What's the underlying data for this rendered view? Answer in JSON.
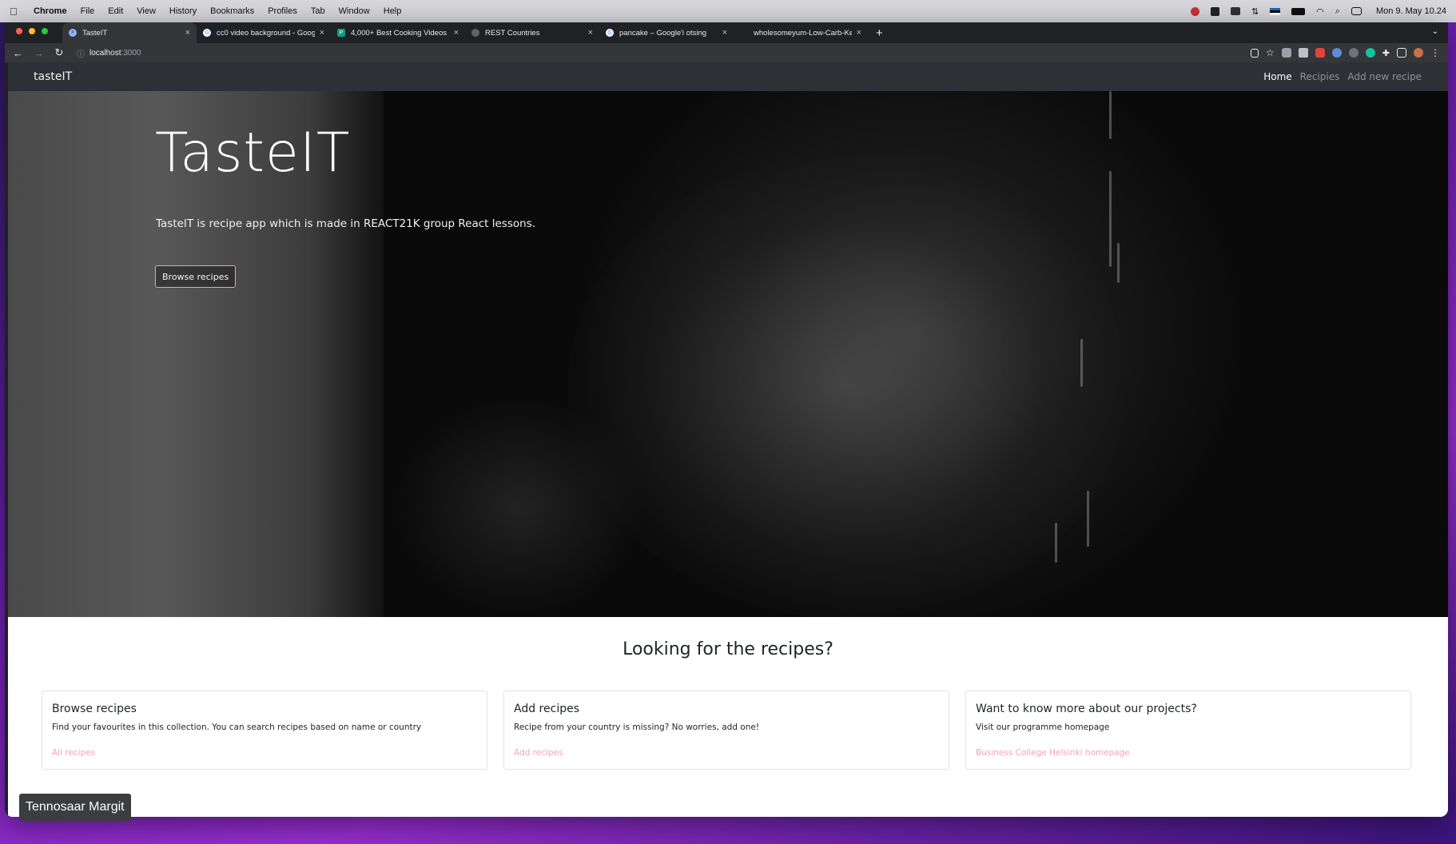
{
  "menubar": {
    "app": "Chrome",
    "items": [
      "File",
      "Edit",
      "View",
      "History",
      "Bookmarks",
      "Profiles",
      "Tab",
      "Window",
      "Help"
    ],
    "clock": "Mon 9. May 10.24"
  },
  "browser": {
    "tabs": [
      {
        "title": "TasteIT",
        "active": true
      },
      {
        "title": "cc0 video background - Googl",
        "active": false
      },
      {
        "title": "4,000+ Best Cooking Videos ·",
        "active": false
      },
      {
        "title": "REST Countries",
        "active": false
      },
      {
        "title": "pancake – Google'i otsing",
        "active": false
      },
      {
        "title": "wholesomeyum-Low-Carb-Ke",
        "active": false
      }
    ],
    "url_host": "localhost",
    "url_port": ":3000"
  },
  "site": {
    "brand": "tasteIT",
    "nav": {
      "home": "Home",
      "recipes": "Recipies",
      "add": "Add new recipe"
    },
    "hero": {
      "title": "TasteIT",
      "text": "TasteIT is recipe app which is made in REACT21K group React lessons.",
      "button": "Browse recipes"
    },
    "section_heading": "Looking for the recipes?",
    "cards": [
      {
        "title": "Browse recipes",
        "text": "Find your favourites in this collection. You can search recipes based on name or country",
        "link": "All recipes"
      },
      {
        "title": "Add recipes",
        "text": "Recipe from your country is missing? No worries, add one!",
        "link": "Add recipes"
      },
      {
        "title": "Want to know more about our projects?",
        "text": "Visit our programme homepage",
        "link": "Business College Helsinki homepage"
      }
    ]
  },
  "name_badge": "Tennosaar Margit"
}
